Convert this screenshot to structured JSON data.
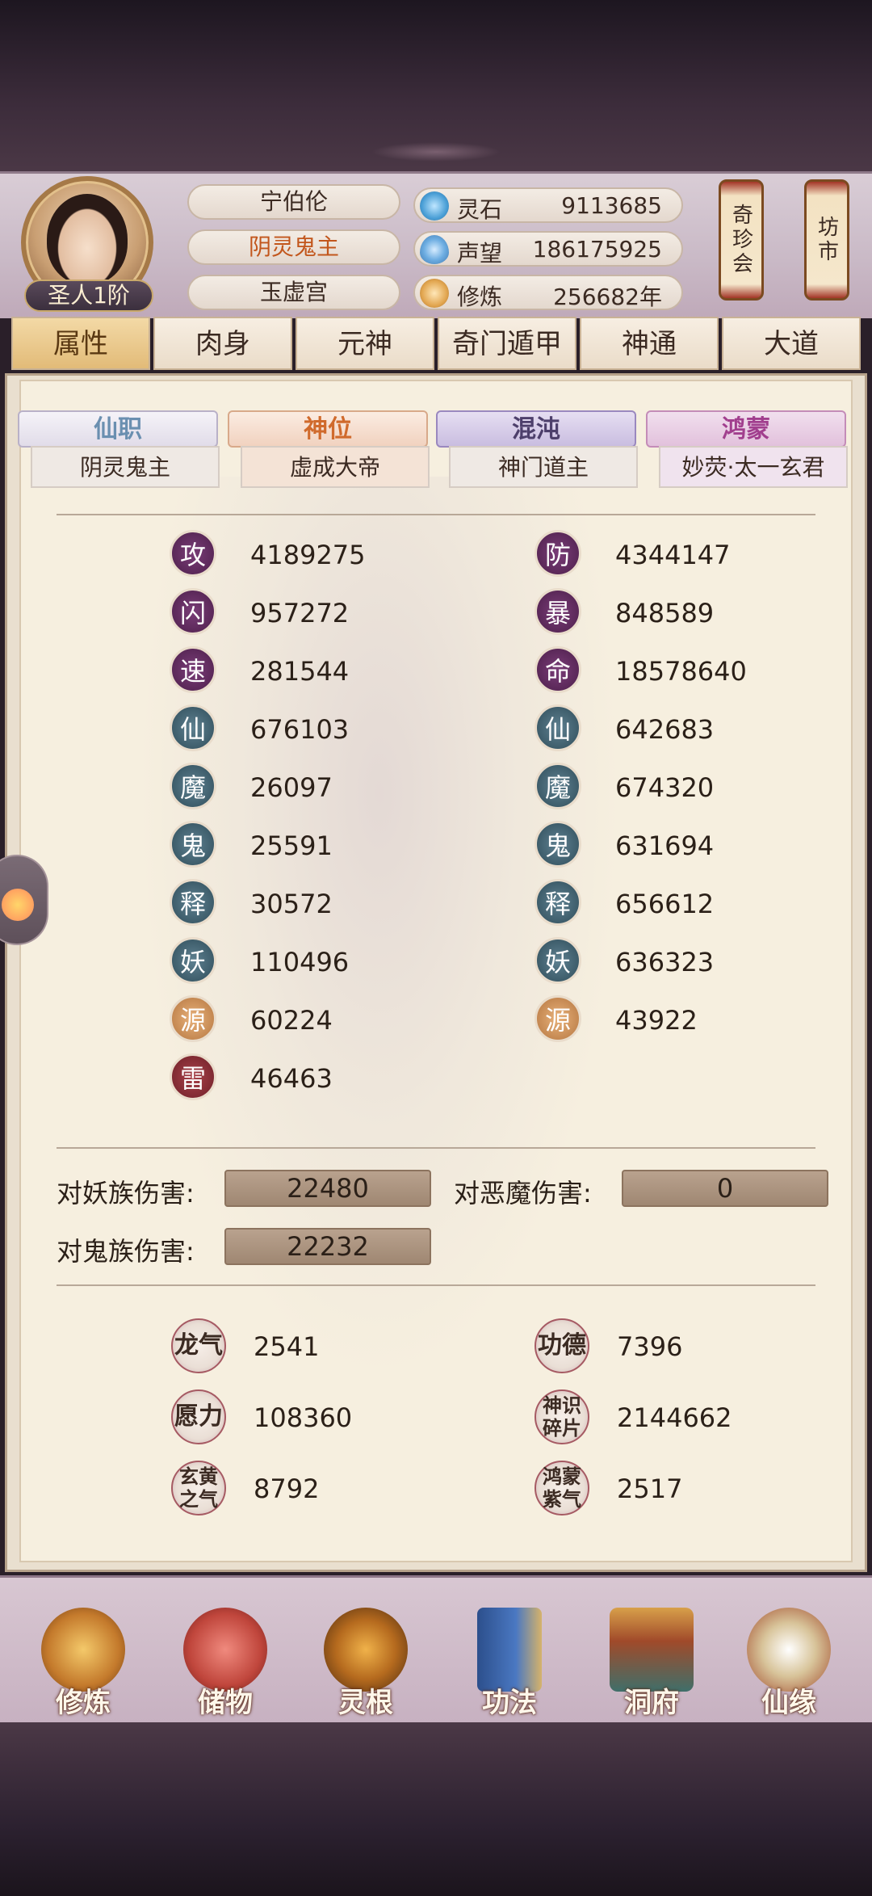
{
  "header": {
    "player_name": "宁伯伦",
    "title": "阴灵鬼主",
    "sect": "玉虚宫",
    "rank": "圣人1阶",
    "resources": [
      {
        "icon": "spirit-stone-icon",
        "label": "灵石",
        "value": "9113685"
      },
      {
        "icon": "reputation-icon",
        "label": "声望",
        "value": "186175925"
      },
      {
        "icon": "cultivation-icon",
        "label": "修炼",
        "value": "256682年"
      }
    ],
    "lanterns": [
      "奇珍会",
      "坊市"
    ]
  },
  "tabs": [
    "属性",
    "肉身",
    "元神",
    "奇门遁甲",
    "神通",
    "大道"
  ],
  "ribbons": [
    {
      "label": "仙职",
      "value": "阴灵鬼主",
      "color": "#6a8fb0"
    },
    {
      "label": "神位",
      "value": "虚成大帝",
      "color": "#d06a2c"
    },
    {
      "label": "混沌",
      "value": "神门道主",
      "color": "#4d3f6b"
    },
    {
      "label": "鸿蒙",
      "value": "妙荧·太一玄君",
      "color": "#a13f8e"
    }
  ],
  "stats": {
    "left": [
      {
        "glyph": "攻",
        "value": "4189275",
        "style": "purple",
        "dot": ""
      },
      {
        "glyph": "闪",
        "value": "957272",
        "style": "purple",
        "dot": ""
      },
      {
        "glyph": "速",
        "value": "281544",
        "style": "purple",
        "dot": ""
      },
      {
        "glyph": "仙",
        "value": "676103",
        "style": "teal",
        "dot": "solid"
      },
      {
        "glyph": "魔",
        "value": "26097",
        "style": "teal",
        "dot": "solid"
      },
      {
        "glyph": "鬼",
        "value": "25591",
        "style": "teal",
        "dot": "solid"
      },
      {
        "glyph": "释",
        "value": "30572",
        "style": "teal",
        "dot": "solid"
      },
      {
        "glyph": "妖",
        "value": "110496",
        "style": "teal",
        "dot": "solid"
      },
      {
        "glyph": "源",
        "value": "60224",
        "style": "tan",
        "dot": "solid"
      },
      {
        "glyph": "雷",
        "value": "46463",
        "style": "red",
        "dot": ""
      }
    ],
    "right": [
      {
        "glyph": "防",
        "value": "4344147",
        "style": "purple",
        "dot": ""
      },
      {
        "glyph": "暴",
        "value": "848589",
        "style": "purple",
        "dot": ""
      },
      {
        "glyph": "命",
        "value": "18578640",
        "style": "purple",
        "dot": ""
      },
      {
        "glyph": "仙",
        "value": "642683",
        "style": "teal",
        "dot": "hollow"
      },
      {
        "glyph": "魔",
        "value": "674320",
        "style": "teal",
        "dot": "hollow"
      },
      {
        "glyph": "鬼",
        "value": "631694",
        "style": "teal",
        "dot": "hollow"
      },
      {
        "glyph": "释",
        "value": "656612",
        "style": "teal",
        "dot": "hollow"
      },
      {
        "glyph": "妖",
        "value": "636323",
        "style": "teal",
        "dot": "hollow"
      },
      {
        "glyph": "源",
        "value": "43922",
        "style": "tan",
        "dot": "hollow"
      }
    ]
  },
  "damage": {
    "demon_race_label": "对妖族伤害:",
    "demon_race_value": "22480",
    "evil_demon_label": "对恶魔伤害:",
    "evil_demon_value": "0",
    "ghost_race_label": "对鬼族伤害:",
    "ghost_race_value": "22232"
  },
  "misc": [
    {
      "glyph": "龙气",
      "value": "2541"
    },
    {
      "glyph": "功德",
      "value": "7396"
    },
    {
      "glyph": "愿力",
      "value": "108360"
    },
    {
      "glyph": "神识碎片",
      "value": "2144662"
    },
    {
      "glyph": "玄黄之气",
      "value": "8792"
    },
    {
      "glyph": "鸿蒙紫气",
      "value": "2517"
    }
  ],
  "bottom_nav": [
    "修炼",
    "储物",
    "灵根",
    "功法",
    "洞府",
    "仙缘"
  ]
}
